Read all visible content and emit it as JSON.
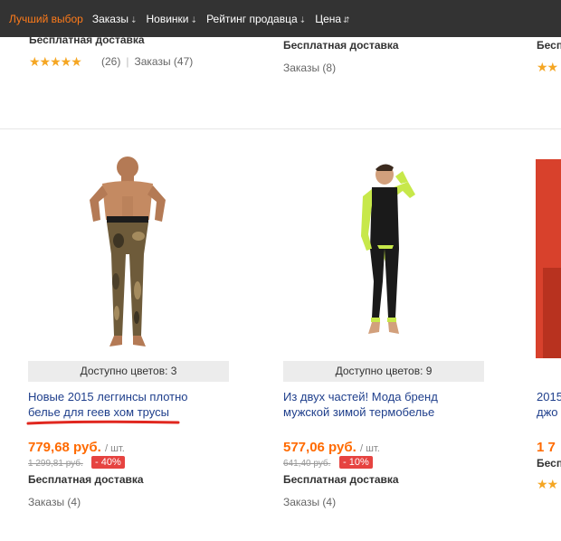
{
  "sortbar": {
    "items": [
      {
        "label": "Лучший выбор",
        "active": true,
        "arrow": ""
      },
      {
        "label": "Заказы",
        "active": false,
        "arrow": "⇣"
      },
      {
        "label": "Новинки",
        "active": false,
        "arrow": "⇣"
      },
      {
        "label": "Рейтинг продавца",
        "active": false,
        "arrow": "⇣"
      },
      {
        "label": "Цена",
        "active": false,
        "arrow": "⇵"
      }
    ]
  },
  "top_row": {
    "col1": {
      "shipping": "Бесплатная доставка",
      "stars": "★★★★★",
      "reviews": "(26)",
      "orders": "Заказы (47)"
    },
    "col2": {
      "shipping": "Бесплатная доставка",
      "orders": "Заказы (8)"
    },
    "col3": {
      "shipping": "Бесп",
      "stars": "★★"
    }
  },
  "products": [
    {
      "colors": "Доступно цветов: 3",
      "title_line1": "Новые 2015 леггинсы плотно",
      "title_line2": "белье для геев хом трусы",
      "price": "779,68 руб.",
      "unit": "/ шт.",
      "old_price": "1 299,81 руб.",
      "discount": "- 40%",
      "shipping": "Бесплатная доставка",
      "orders": "Заказы (4)"
    },
    {
      "colors": "Доступно цветов: 9",
      "title_line1": "Из двух частей! Мода бренд",
      "title_line2": "мужской зимой термобелье",
      "price": "577,06 руб.",
      "unit": "/ шт.",
      "old_price": "641,40 руб.",
      "discount": "- 10%",
      "shipping": "Бесплатная доставка",
      "orders": "Заказы (4)"
    },
    {
      "title_line1": "2015",
      "title_line2": "джо",
      "price": "1 7",
      "shipping": "Бесп",
      "stars": "★★"
    }
  ],
  "colors": {
    "accent": "#ff6a00",
    "active_sort": "#ff7b1a",
    "discount": "#e64340",
    "link": "#1f3f8c",
    "star": "#f5a623",
    "bar": "#333333"
  }
}
